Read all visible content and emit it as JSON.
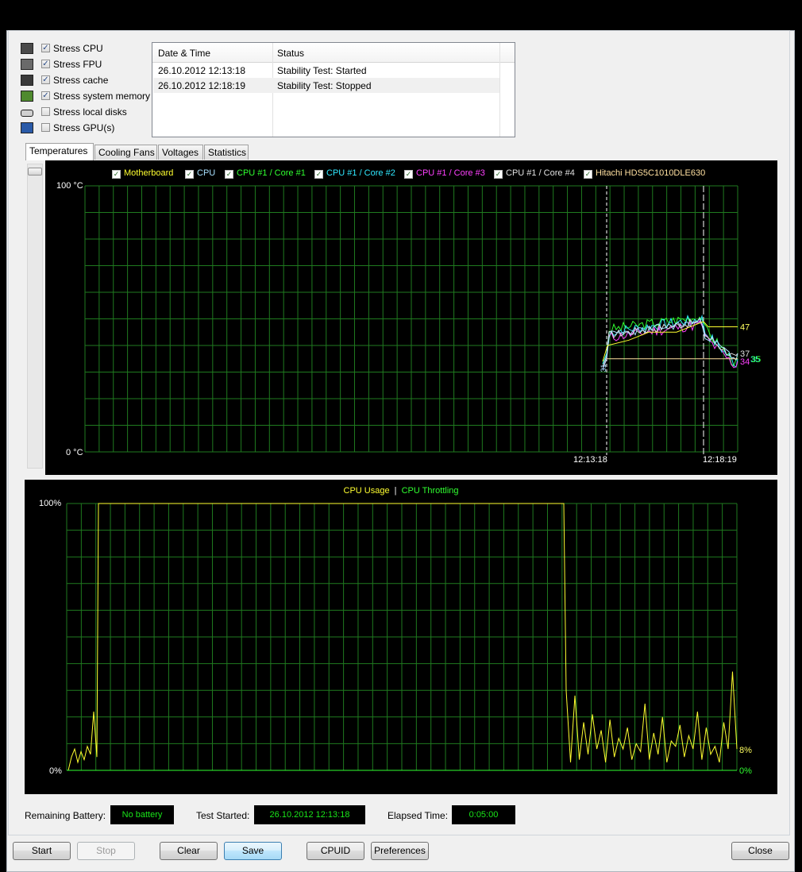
{
  "stress_options": [
    {
      "label": "Stress CPU",
      "checked": true,
      "icon": "cpu-icon"
    },
    {
      "label": "Stress FPU",
      "checked": true,
      "icon": "fpu-icon"
    },
    {
      "label": "Stress cache",
      "checked": true,
      "icon": "cache-icon"
    },
    {
      "label": "Stress system memory",
      "checked": true,
      "icon": "memory-icon"
    },
    {
      "label": "Stress local disks",
      "checked": false,
      "icon": "disk-icon"
    },
    {
      "label": "Stress GPU(s)",
      "checked": false,
      "icon": "gpu-icon"
    }
  ],
  "log": {
    "headers": {
      "datetime": "Date & Time",
      "status": "Status"
    },
    "rows": [
      {
        "datetime": "26.10.2012 12:13:18",
        "status": "Stability Test: Started"
      },
      {
        "datetime": "26.10.2012 12:18:19",
        "status": "Stability Test: Stopped"
      }
    ]
  },
  "tabs": [
    "Temperatures",
    "Cooling Fans",
    "Voltages",
    "Statistics"
  ],
  "active_tab": "Temperatures",
  "temp_chart": {
    "legend": [
      {
        "label": "Motherboard",
        "color": "#ffff30"
      },
      {
        "label": "CPU",
        "color": "#a8e0ff"
      },
      {
        "label": "CPU #1 / Core #1",
        "color": "#30ff30"
      },
      {
        "label": "CPU #1 / Core #2",
        "color": "#30e8ff"
      },
      {
        "label": "CPU #1 / Core #3",
        "color": "#ff40ff"
      },
      {
        "label": "CPU #1 / Core #4",
        "color": "#e0e0e0"
      },
      {
        "label": "Hitachi HDS5C1010DLE630",
        "color": "#ffe0a0"
      }
    ],
    "y_top": "100 °C",
    "y_bottom": "0 °C",
    "marker_start": "12:13:18",
    "marker_stop": "12:18:19",
    "end_labels": [
      {
        "text": "47",
        "value": 47,
        "color": "#ffff60"
      },
      {
        "text": "37",
        "value": 37,
        "color": "#e0e0e0"
      },
      {
        "text": "35",
        "value": 35,
        "color": "#30e8ff"
      },
      {
        "text": "34",
        "value": 34,
        "color": "#ff40ff"
      },
      {
        "text": "35",
        "value": 35,
        "color": "#30ff30"
      }
    ],
    "start_label": "31"
  },
  "usage_chart": {
    "title_usage": "CPU Usage",
    "separator": "|",
    "title_throttle": "CPU Throttling",
    "color_usage": "#ffff30",
    "color_throttle": "#30ff30",
    "y_top": "100%",
    "y_bottom": "0%",
    "end_usage": "8%",
    "end_throttle": "0%"
  },
  "chart_data": [
    {
      "type": "line",
      "title": "",
      "ylabel": "°C",
      "ylim": [
        0,
        100
      ],
      "x": [
        "12:13:18",
        "12:18:19"
      ],
      "series": [
        {
          "name": "Motherboard",
          "values": [
            34,
            47
          ]
        },
        {
          "name": "CPU",
          "values": [
            31,
            37
          ]
        },
        {
          "name": "CPU #1 / Core #1",
          "values": [
            38,
            35
          ]
        },
        {
          "name": "CPU #1 / Core #2",
          "values": [
            38,
            35
          ]
        },
        {
          "name": "CPU #1 / Core #3",
          "values": [
            36,
            34
          ]
        },
        {
          "name": "CPU #1 / Core #4",
          "values": [
            37,
            37
          ]
        }
      ]
    },
    {
      "type": "line",
      "title": "",
      "ylim": [
        0,
        100
      ],
      "series": [
        {
          "name": "CPU Usage",
          "values": [
            0,
            5,
            8,
            3,
            7,
            4,
            9,
            6,
            22,
            5,
            100,
            100,
            100,
            100,
            100,
            100,
            100,
            100,
            100,
            100,
            100,
            100,
            100,
            100,
            100,
            100,
            100,
            100,
            100,
            100,
            100,
            100,
            100,
            100,
            100,
            100,
            100,
            100,
            100,
            100,
            100,
            100,
            100,
            100,
            100,
            100,
            100,
            100,
            100,
            100,
            100,
            100,
            100,
            100,
            100,
            100,
            100,
            100,
            100,
            30,
            3,
            28,
            4,
            18,
            6,
            21,
            8,
            15,
            3,
            19,
            5,
            12,
            8,
            16,
            4,
            10,
            7,
            25,
            4,
            14,
            6,
            20,
            3,
            11,
            9,
            17,
            5,
            13,
            8,
            22,
            4,
            16,
            6,
            9,
            3,
            18,
            8,
            37,
            8
          ]
        },
        {
          "name": "CPU Throttling",
          "values": [
            0,
            0
          ]
        }
      ]
    }
  ],
  "status": {
    "battery_label": "Remaining Battery:",
    "battery_value": "No battery",
    "started_label": "Test Started:",
    "started_value": "26.10.2012 12:13:18",
    "elapsed_label": "Elapsed Time:",
    "elapsed_value": "0:05:00"
  },
  "buttons": {
    "start": "Start",
    "stop": "Stop",
    "clear": "Clear",
    "save": "Save",
    "cpuid": "CPUID",
    "preferences": "Preferences",
    "close": "Close"
  }
}
